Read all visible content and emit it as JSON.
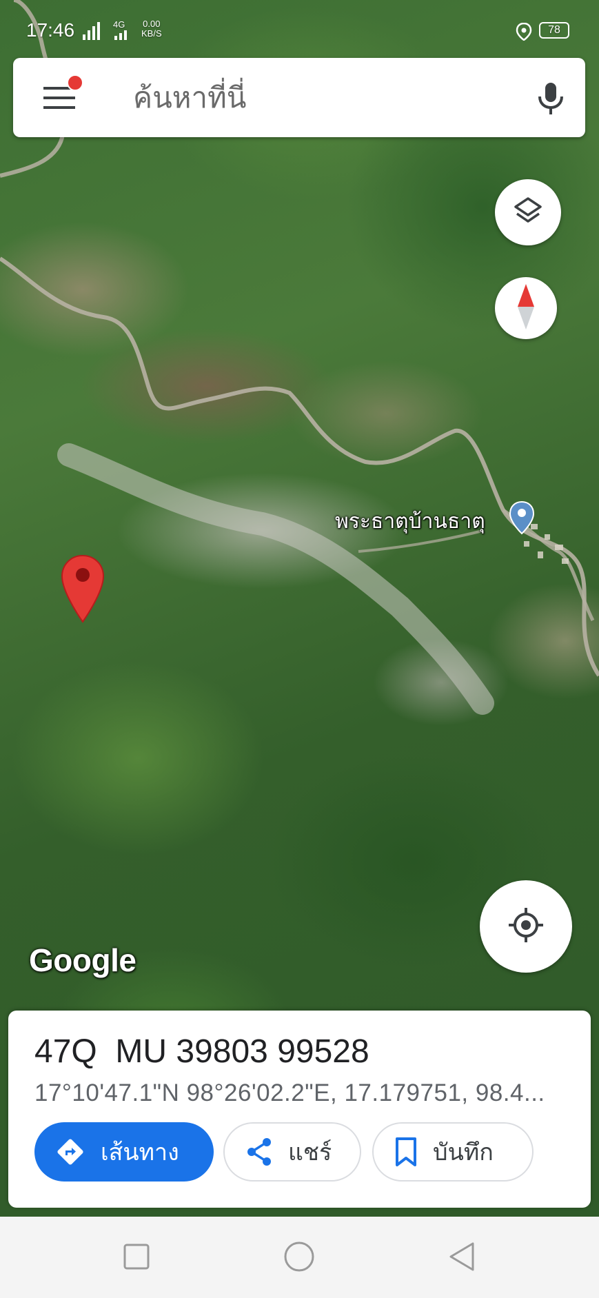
{
  "status_bar": {
    "time": "17:46",
    "network": "4G",
    "data_speed": "0.00\nKB/S",
    "battery": "78"
  },
  "search": {
    "placeholder": "ค้นหาที่นี่"
  },
  "map": {
    "place_label": "พระธาตุบ้านธาตุ",
    "logo": "Google"
  },
  "info_card": {
    "grid_reference": "47Q  MU 39803 99528",
    "coordinates": "17°10'47.1\"N 98°26'02.2\"E, 17.179751, 98.4..."
  },
  "actions": {
    "directions_label": "เส้นทาง",
    "share_label": "แชร์",
    "save_label": "บันทึก"
  },
  "colors": {
    "accent": "#1a73e8",
    "pin_red": "#e53935",
    "pin_blue": "#5b8fc7"
  },
  "icons": [
    "menu-icon",
    "mic-icon",
    "layers-icon",
    "compass-icon",
    "my-location-icon",
    "directions-icon",
    "share-icon",
    "bookmark-icon",
    "location-pin-icon"
  ]
}
